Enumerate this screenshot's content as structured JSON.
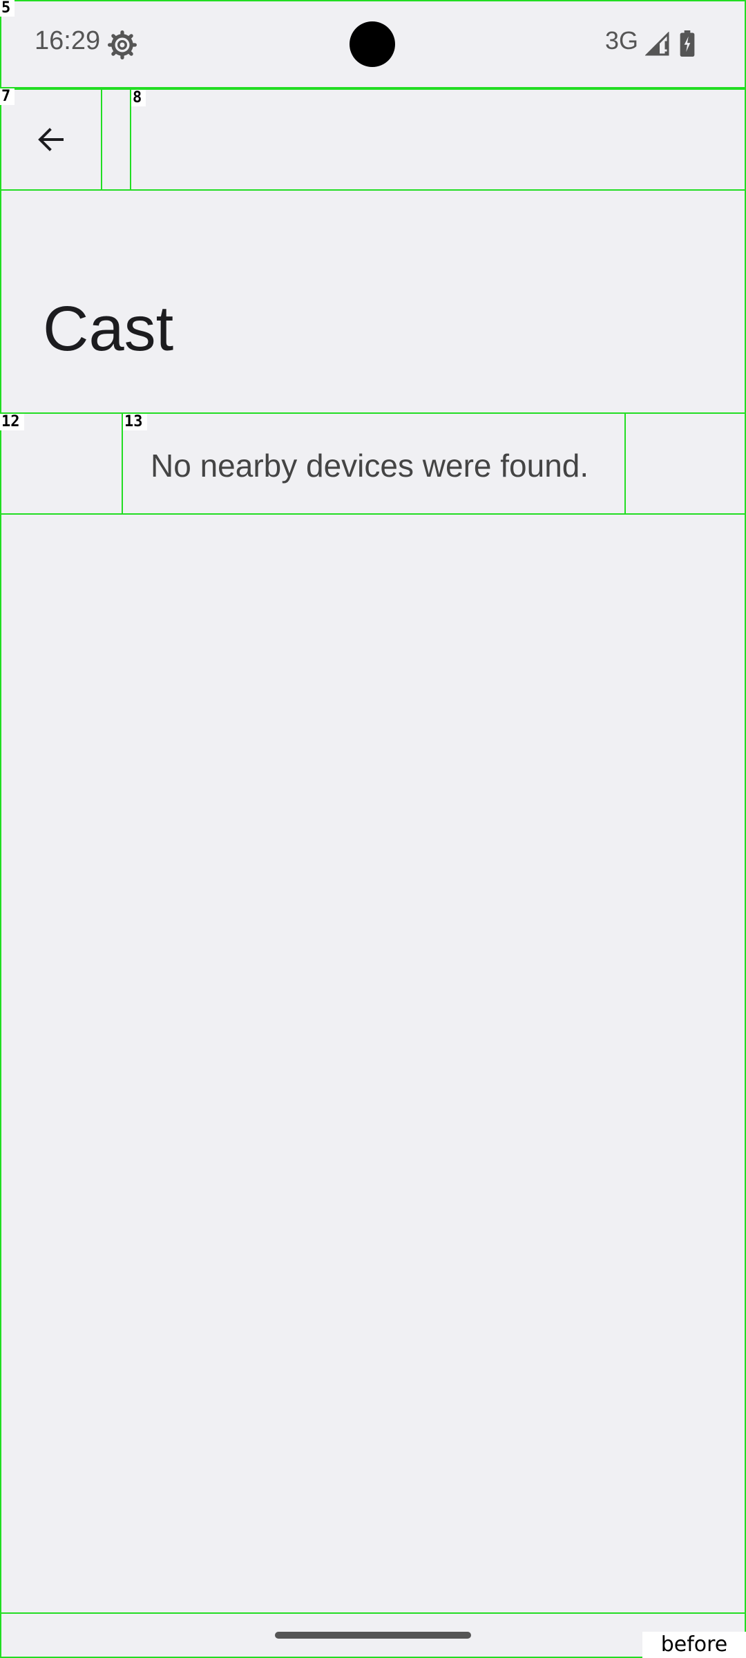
{
  "status_bar": {
    "time": "16:29",
    "network": "3G",
    "icons": [
      "gear-icon",
      "signal-icon",
      "battery-charging-icon"
    ]
  },
  "overlay_tags": {
    "status_bar": "5",
    "back_cell": "7",
    "title_cell": "8",
    "msg_left": "12",
    "msg_center": "13"
  },
  "app_bar": {
    "back_icon": "arrow-left-icon"
  },
  "header": {
    "title": "Cast"
  },
  "content": {
    "empty_message": "No nearby devices were found."
  },
  "footer_label": "before",
  "colors": {
    "background": "#f0f0f3",
    "outline": "#22dd22",
    "text_primary": "#1c1c1f",
    "text_secondary": "#444444"
  }
}
